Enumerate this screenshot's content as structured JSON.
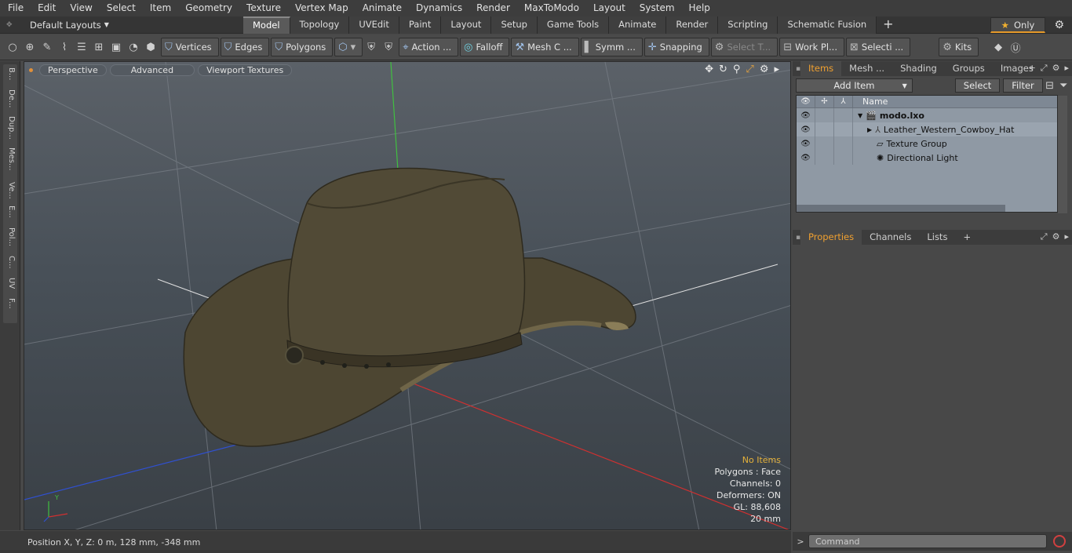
{
  "menu": [
    "File",
    "Edit",
    "View",
    "Select",
    "Item",
    "Geometry",
    "Texture",
    "Vertex Map",
    "Animate",
    "Dynamics",
    "Render",
    "MaxToModo",
    "Layout",
    "System",
    "Help"
  ],
  "layout_bar": {
    "layout_select": "Default Layouts",
    "tabs": [
      "Model",
      "Topology",
      "UVEdit",
      "Paint",
      "Layout",
      "Setup",
      "Game Tools",
      "Animate",
      "Render",
      "Scripting",
      "Schematic Fusion"
    ],
    "active_tab": "Model",
    "only_label": "Only"
  },
  "toolbar": {
    "vertices": "Vertices",
    "edges": "Edges",
    "polygons": "Polygons",
    "action": "Action ...",
    "falloff": "Falloff",
    "mesh": "Mesh C ...",
    "symm": "Symm ...",
    "snapping": "Snapping",
    "select_t": "Select T...",
    "work_pl": "Work Pl...",
    "selecti": "Selecti ...",
    "kits": "Kits"
  },
  "left_tabs": [
    "B...",
    "De...",
    "Dup...",
    "Mes...",
    "Ve...",
    "E...",
    "Pol...",
    "C...",
    "UV",
    "F..."
  ],
  "viewport": {
    "buttons": [
      "Perspective",
      "Advanced",
      "Viewport Textures"
    ],
    "stats": {
      "no_items": "No Items",
      "polygons": "Polygons : Face",
      "channels": "Channels: 0",
      "deformers": "Deformers: ON",
      "gl": "GL: 88,608",
      "scale": "20 mm"
    }
  },
  "status": {
    "position": "Position X, Y, Z:   0 m, 128 mm, -348 mm"
  },
  "items_panel": {
    "tabs": [
      "Items",
      "Mesh ...",
      "Shading",
      "Groups",
      "Images"
    ],
    "active_tab": "Items",
    "add_item": "Add Item",
    "select": "Select",
    "filter": "Filter",
    "name_header": "Name",
    "rows": [
      {
        "label": "modo.lxo"
      },
      {
        "label": "Leather_Western_Cowboy_Hat"
      },
      {
        "label": "Texture Group"
      },
      {
        "label": "Directional Light"
      }
    ]
  },
  "properties_panel": {
    "tabs": [
      "Properties",
      "Channels",
      "Lists"
    ],
    "active_tab": "Properties"
  },
  "command": {
    "placeholder": "Command"
  },
  "colors": {
    "accent": "#f0a030",
    "axis_x": "#d03030",
    "axis_y": "#40c040",
    "axis_z": "#3050d0"
  }
}
